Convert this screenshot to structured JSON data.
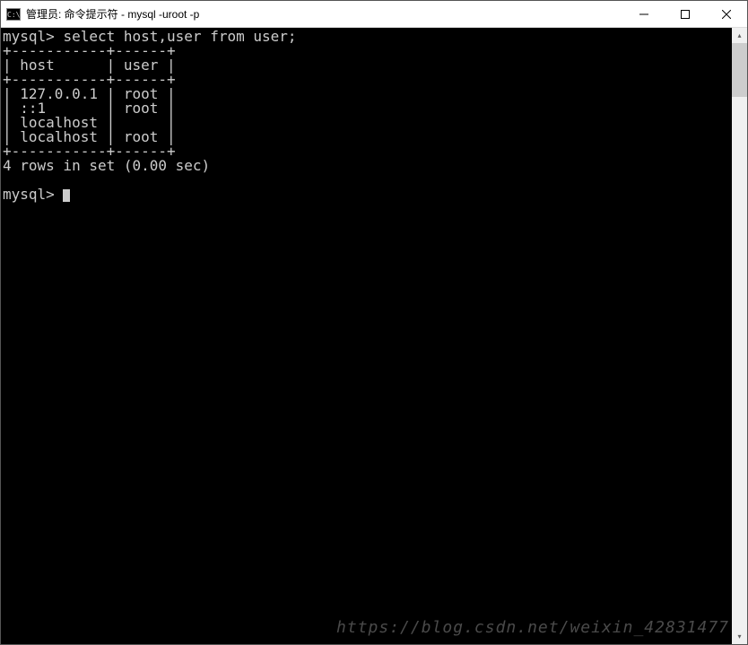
{
  "titlebar": {
    "icon_text": "C:\\",
    "title": "管理员: 命令提示符 - mysql  -uroot -p"
  },
  "terminal": {
    "prompt1_prefix": "mysql> ",
    "command": "select host,user from user;",
    "table_divider": "+-----------+------+",
    "table_header": "| host      | user |",
    "rows": [
      "| 127.0.0.1 | root |",
      "| ::1       | root |",
      "| localhost |      |",
      "| localhost | root |"
    ],
    "result_summary": "4 rows in set (0.00 sec)",
    "prompt2_prefix": "mysql> "
  },
  "watermark": "https://blog.csdn.net/weixin_42831477"
}
